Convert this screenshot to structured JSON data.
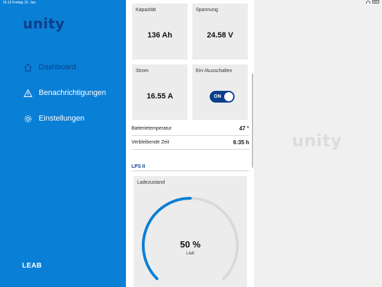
{
  "statusbar": {
    "time_date": "16:19   Freitag 19. Jan."
  },
  "sidebar": {
    "logo": "unity",
    "items": [
      {
        "label": "Dashboard",
        "icon": "home-icon",
        "active": true
      },
      {
        "label": "Benachrichtigungen",
        "icon": "warning-icon",
        "active": false
      },
      {
        "label": "Einstellungen",
        "icon": "gear-icon",
        "active": false
      }
    ],
    "brand": "LEAB"
  },
  "cards": {
    "kapazitaet": {
      "label": "Kapazität",
      "value": "136 Ah"
    },
    "spannung": {
      "label": "Spannung",
      "value": "24.58 V"
    },
    "strom": {
      "label": "Strom",
      "value": "16.55 A"
    },
    "ein_aus": {
      "label": "Ein-/Ausschalten",
      "toggle_label": "ON",
      "on": true
    }
  },
  "rows": [
    {
      "label": "Batterietemperatur",
      "value": "47 °"
    },
    {
      "label": "Verbleibende Zeit",
      "value": "6:35 h"
    }
  ],
  "section": {
    "title": "LPS II"
  },
  "gauge": {
    "label": "Ladezustand",
    "value_text": "50 %",
    "status": "Lädt",
    "percent": 50,
    "fill_color": "#0a7fd6",
    "track_color": "#d9d9d9"
  },
  "right": {
    "watermark": "unity"
  },
  "colors": {
    "sidebar": "#0a7fd6",
    "accent_dark": "#0c3f8a"
  }
}
